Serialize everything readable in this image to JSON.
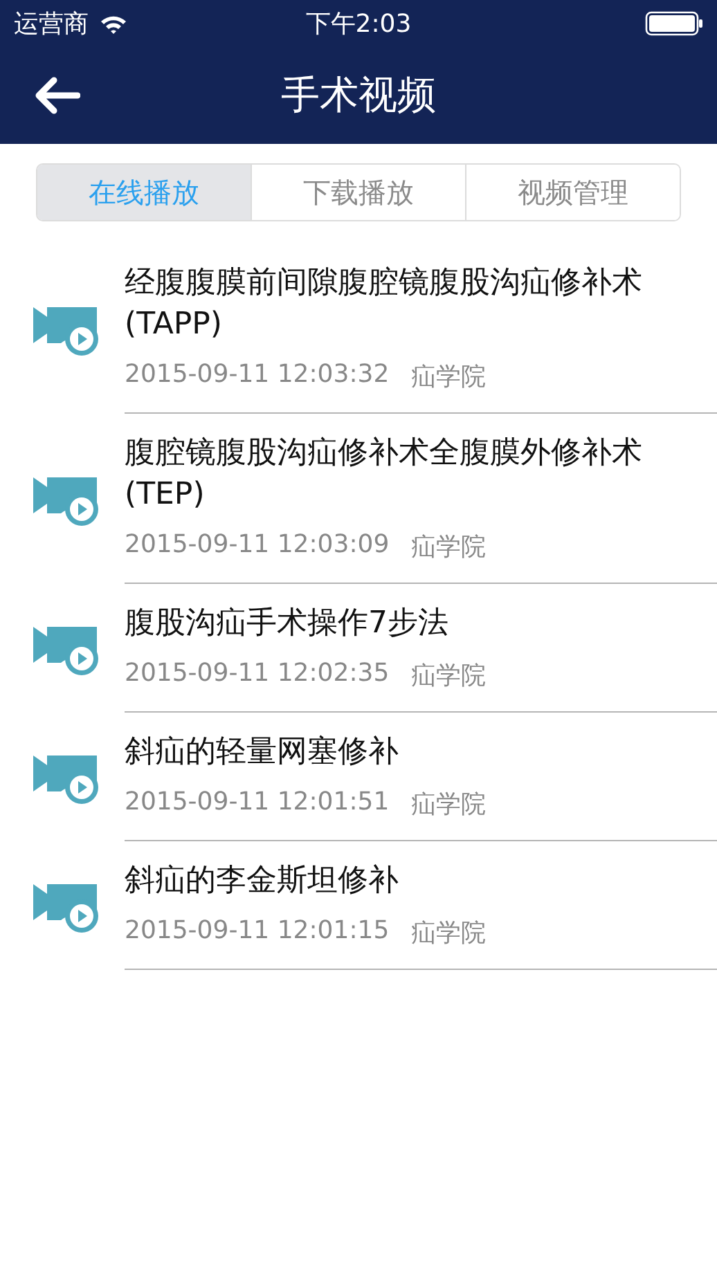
{
  "status_bar": {
    "carrier": "运营商",
    "time": "下午2:03"
  },
  "nav": {
    "title": "手术视频"
  },
  "tabs": [
    {
      "label": "在线播放",
      "selected": true
    },
    {
      "label": "下载播放",
      "selected": false
    },
    {
      "label": "视频管理",
      "selected": false
    }
  ],
  "videos": [
    {
      "title": "经腹腹膜前间隙腹腔镜腹股沟疝修补术(TAPP)",
      "date": "2015-09-11 12:03:32",
      "source": "疝学院"
    },
    {
      "title": "腹腔镜腹股沟疝修补术全腹膜外修补术(TEP)",
      "date": "2015-09-11 12:03:09",
      "source": "疝学院"
    },
    {
      "title": "腹股沟疝手术操作7步法",
      "date": "2015-09-11 12:02:35",
      "source": "疝学院"
    },
    {
      "title": "斜疝的轻量网塞修补",
      "date": "2015-09-11 12:01:51",
      "source": "疝学院"
    },
    {
      "title": "斜疝的李金斯坦修补",
      "date": "2015-09-11 12:01:15",
      "source": "疝学院"
    }
  ]
}
